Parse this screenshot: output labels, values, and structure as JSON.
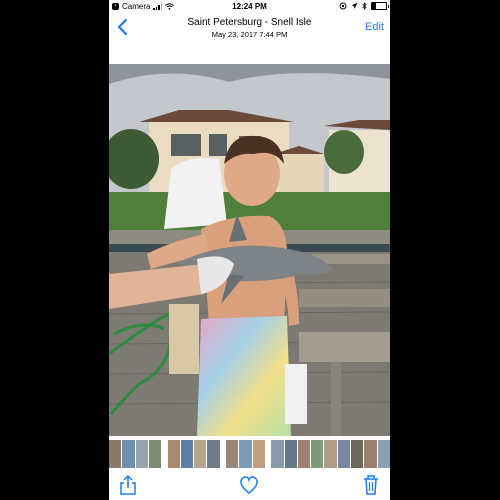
{
  "status": {
    "back_app": "Camera",
    "time": "12:24 PM",
    "battery_level": 0.25
  },
  "nav": {
    "title": "Saint Petersburg - Snell Isle",
    "subtitle": "May 23, 2017  7:44 PM",
    "edit_label": "Edit",
    "back_icon": "chevron-left-icon"
  },
  "photo": {
    "description_icon": "photo-view"
  },
  "thumbnails": {
    "colors": [
      "#8a7a6a",
      "#6d8fb0",
      "#9aa3ad",
      "#7c8c6e",
      "#a98a6c",
      "#5f7fa0",
      "#b5a58f",
      "#6e7c8a",
      "#998877",
      "#7a9ab8",
      "#c0a080",
      "#8899aa",
      "#667788",
      "#a08070",
      "#7e9a7a",
      "#b09a88",
      "#7688a0",
      "#6a6a5a",
      "#9a7f6c",
      "#8aa0b4"
    ],
    "accent": "#1a7cf5"
  },
  "toolbar": {
    "share_icon": "share-icon",
    "favorite_icon": "heart-icon",
    "delete_icon": "trash-icon",
    "tint": "#1a7cf5"
  }
}
